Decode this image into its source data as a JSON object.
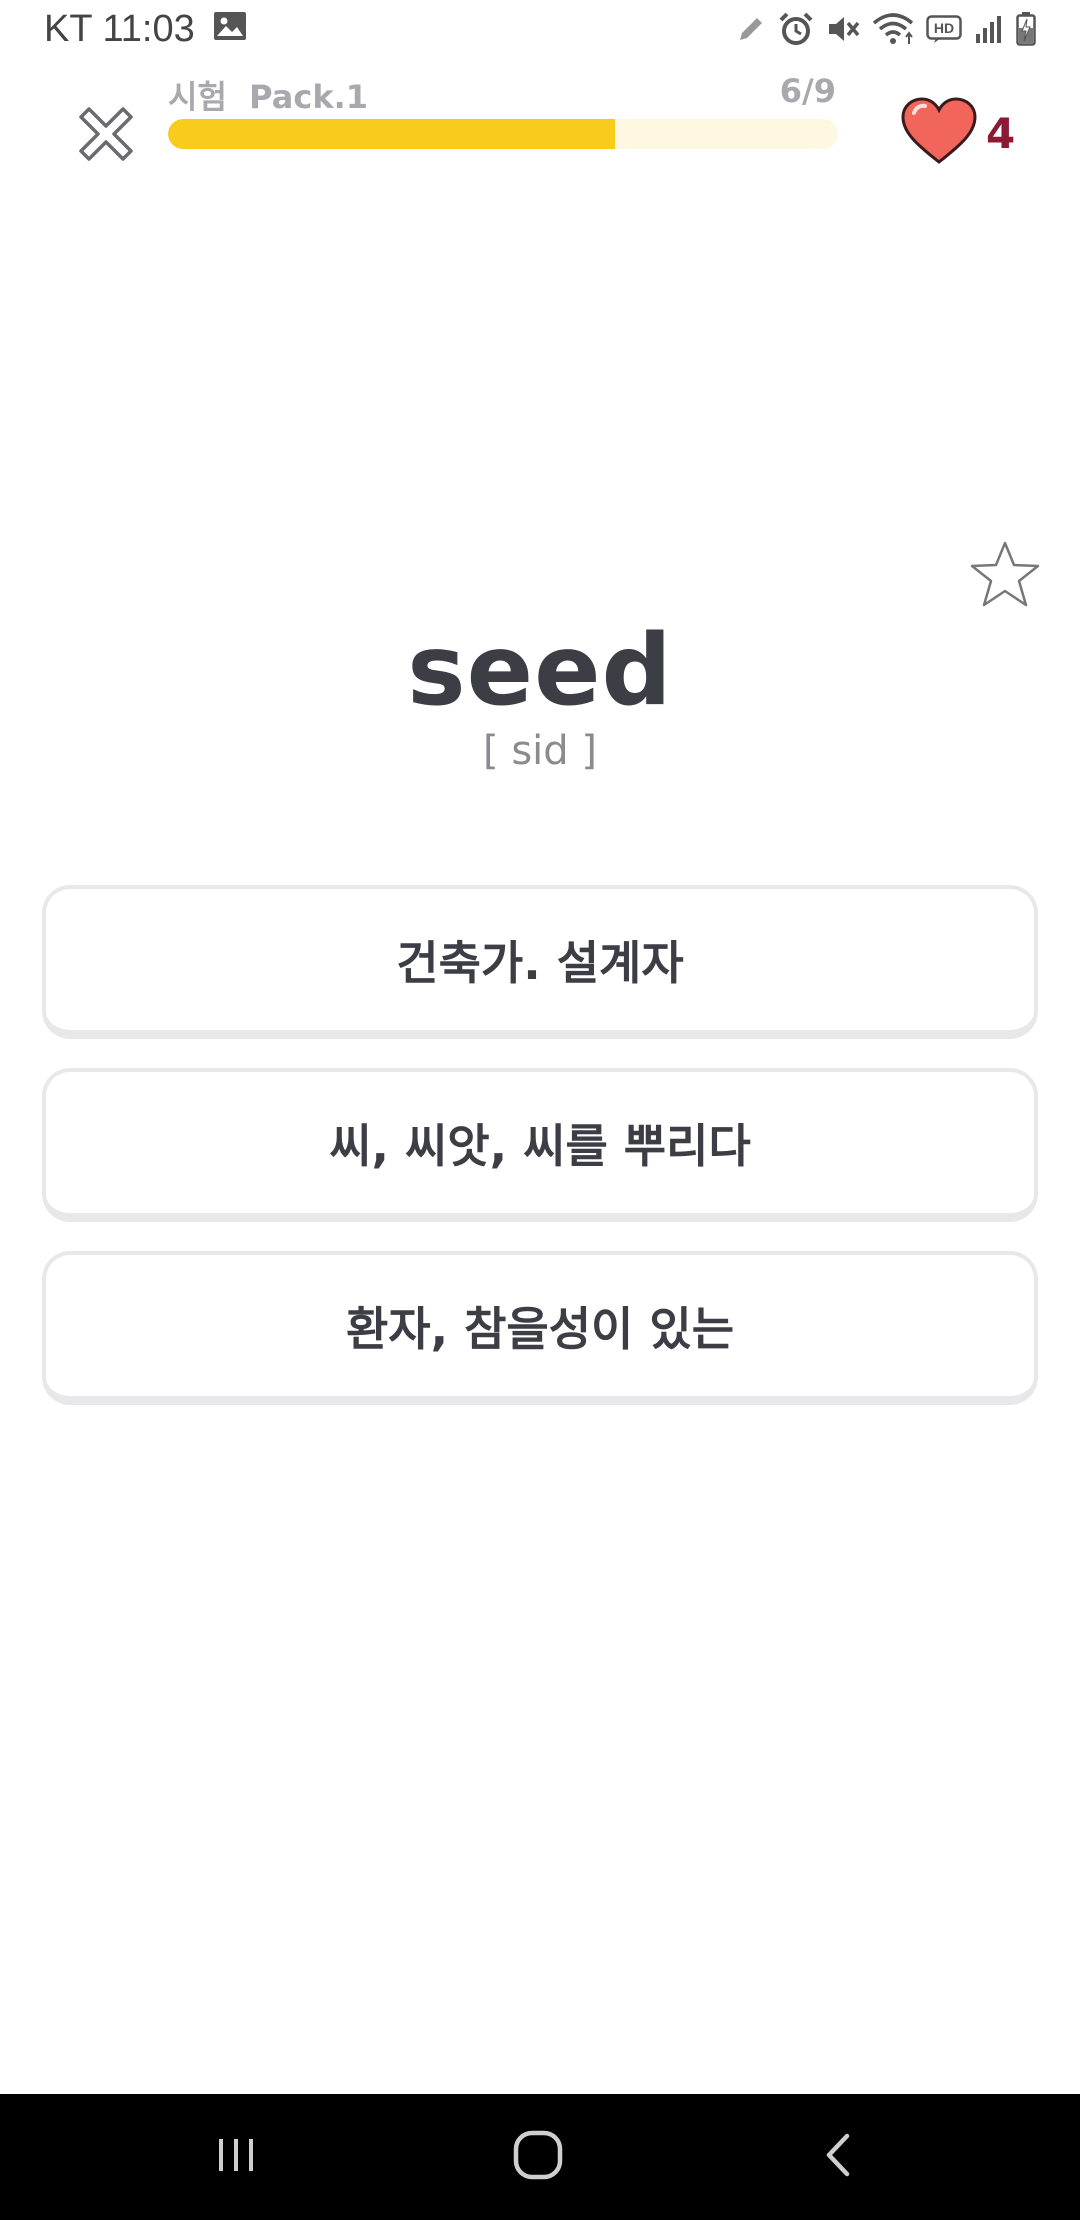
{
  "status_bar": {
    "carrier": "KT",
    "time": "11:03",
    "icons": [
      "image-icon",
      "pencil-icon",
      "alarm-icon",
      "mute-icon",
      "wifi-icon",
      "hd-icon",
      "signal-icon",
      "battery-charging-icon"
    ]
  },
  "header": {
    "close_icon": "close-icon",
    "pack_label": "시험  Pack.1",
    "progress_text": "6/9",
    "progress": {
      "current": 6,
      "total": 9,
      "fraction": 0.667
    },
    "lives_count": "4",
    "colors": {
      "progress_fill": "#f9cb1d",
      "progress_track": "#fff8e1",
      "heart": "#f2655a",
      "lives": "#8b1a34"
    }
  },
  "card": {
    "bookmark_icon": "star-icon",
    "word": "seed",
    "pronunciation": "[ sid ]"
  },
  "choices": [
    {
      "label": "건축가. 설계자"
    },
    {
      "label": "씨, 씨앗, 씨를 뿌리다"
    },
    {
      "label": "환자, 참을성이 있는"
    }
  ],
  "nav_bar": {
    "icons": [
      "recent-apps-icon",
      "home-icon",
      "back-icon"
    ]
  }
}
